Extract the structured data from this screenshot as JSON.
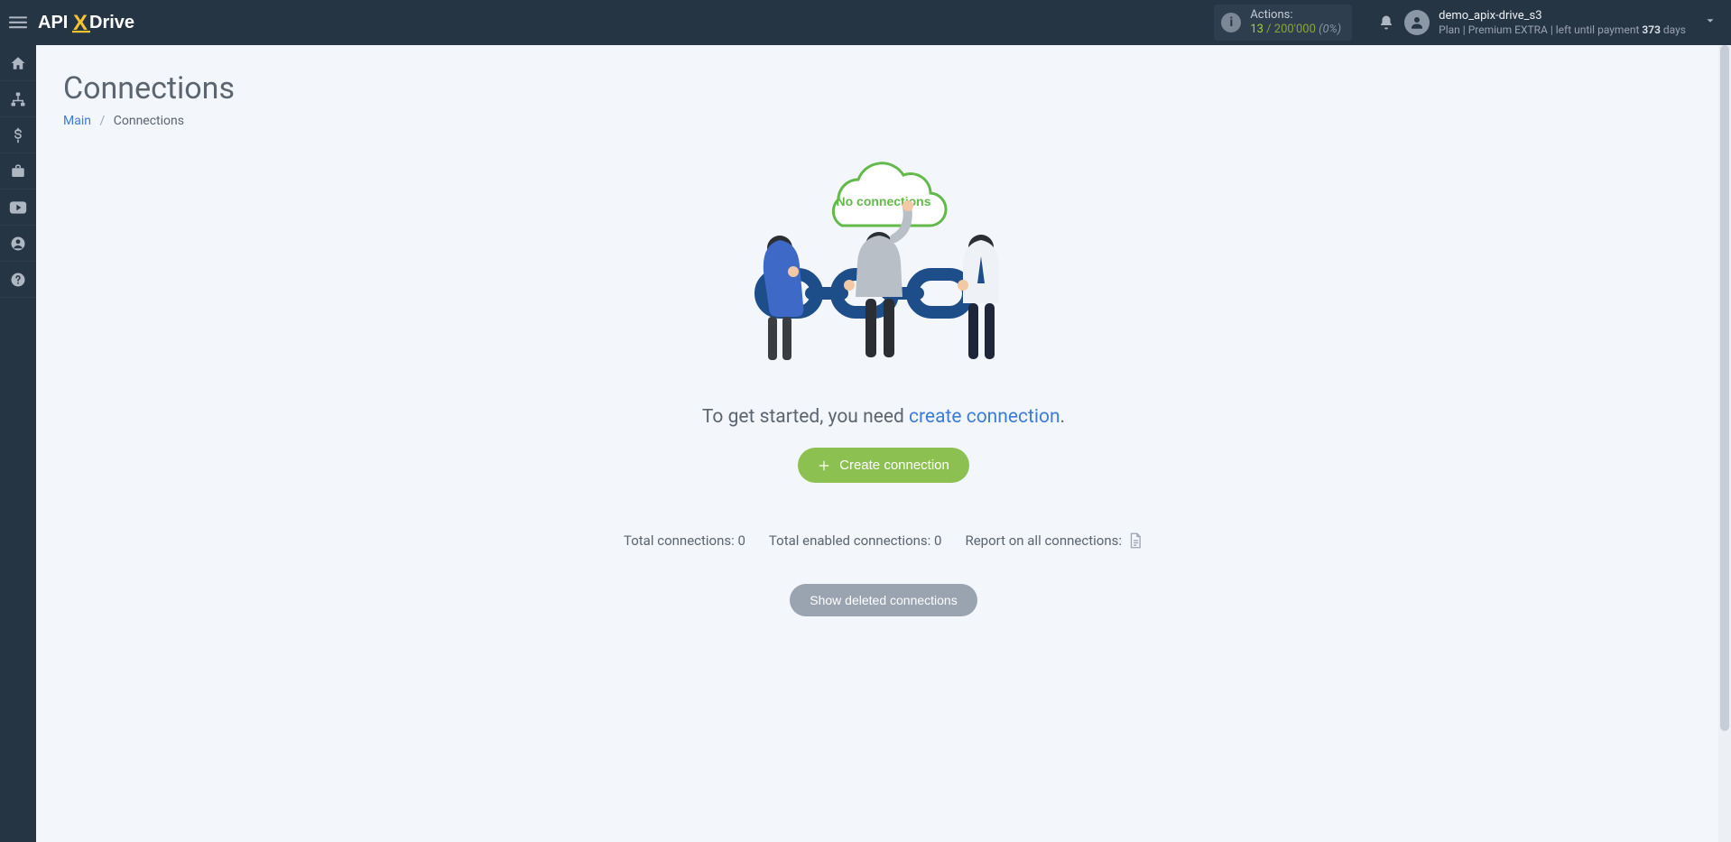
{
  "header": {
    "logo_brand_part1": "API",
    "logo_brand_x": "X",
    "logo_brand_part2": "Drive",
    "actions_label": "Actions:",
    "actions_used": "13",
    "actions_sep": " / ",
    "actions_limit": "200'000",
    "actions_pct": "(0%)",
    "user_name": "demo_apix-drive_s3",
    "plan_prefix": "Plan | ",
    "plan_name": "Premium EXTRA",
    "plan_mid": " |  left until payment ",
    "plan_days": "373",
    "plan_days_suffix": " days"
  },
  "sidebar": {
    "items": [
      {
        "id": "home"
      },
      {
        "id": "connections"
      },
      {
        "id": "billing"
      },
      {
        "id": "briefcase"
      },
      {
        "id": "video"
      },
      {
        "id": "account"
      },
      {
        "id": "help"
      }
    ]
  },
  "page": {
    "title": "Connections",
    "breadcrumb_main": "Main",
    "breadcrumb_sep": "/",
    "breadcrumb_current": "Connections"
  },
  "empty": {
    "cloud_label": "No connections",
    "get_started_prefix": "To get started, you need ",
    "get_started_link": "create connection",
    "get_started_suffix": ".",
    "create_btn": "Create connection"
  },
  "stats": {
    "total_label": "Total connections: ",
    "total_value": "0",
    "enabled_label": "Total enabled connections: ",
    "enabled_value": "0",
    "report_label": "Report on all connections:"
  },
  "deleted": {
    "show_btn": "Show deleted connections"
  },
  "colors": {
    "accent_green": "#8cc152",
    "link_blue": "#3b7dd8",
    "bg_dark": "#263544"
  }
}
